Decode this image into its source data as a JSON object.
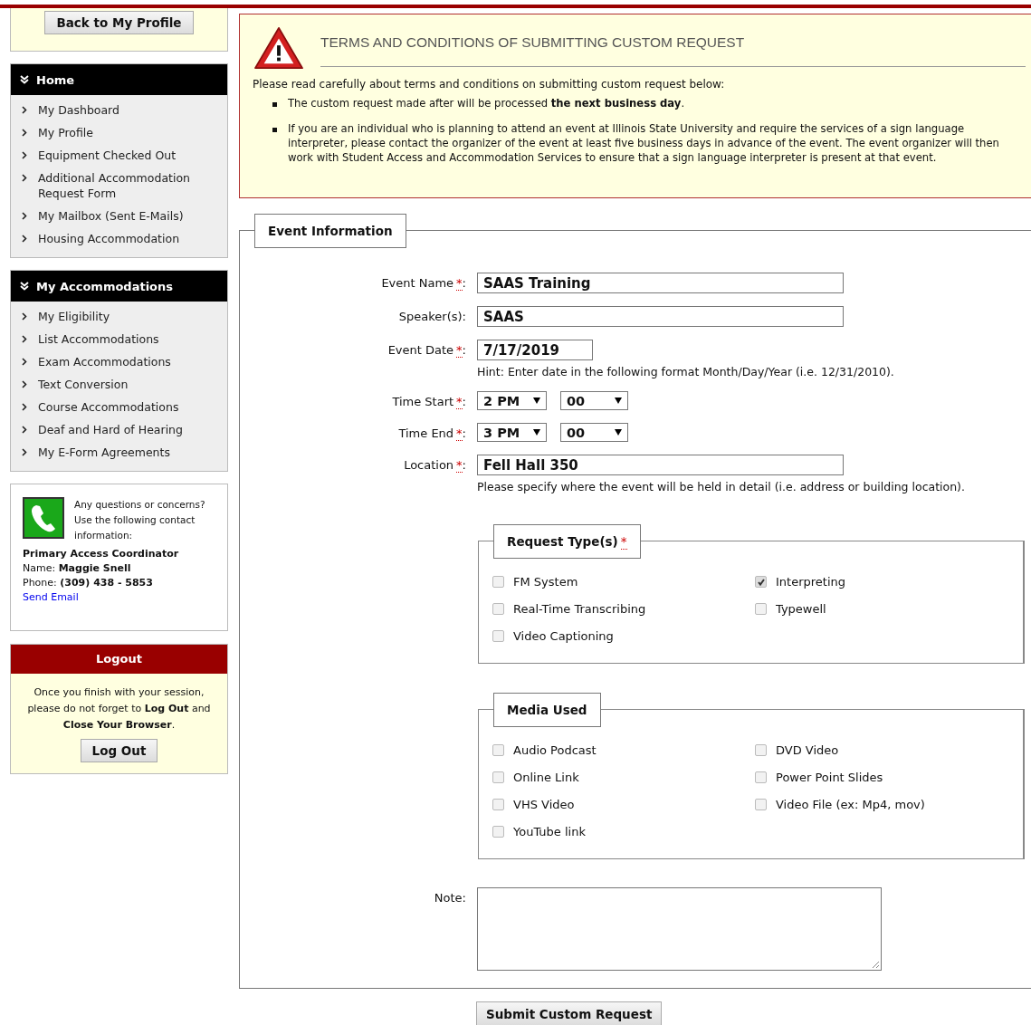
{
  "sidebar": {
    "back_button": "Back to My Profile",
    "menus": [
      {
        "title": "Home",
        "items": [
          {
            "label": "My Dashboard"
          },
          {
            "label": "My Profile"
          },
          {
            "label": "Equipment Checked Out"
          },
          {
            "label": "Additional Accommodation Request Form"
          },
          {
            "label": "My Mailbox (Sent E-Mails)"
          },
          {
            "label": "Housing Accommodation"
          }
        ]
      },
      {
        "title": "My Accommodations",
        "items": [
          {
            "label": "My Eligibility"
          },
          {
            "label": "List Accommodations"
          },
          {
            "label": "Exam Accommodations"
          },
          {
            "label": "Text Conversion"
          },
          {
            "label": "Course Accommodations"
          },
          {
            "label": "Deaf and Hard of Hearing"
          },
          {
            "label": "My E-Form Agreements"
          }
        ]
      }
    ],
    "contact": {
      "intro": "Any questions or concerns? Use the following contact information:",
      "role": "Primary Access Coordinator",
      "name": "Name: **Maggie Snell**",
      "phone": "Phone: **(309) 438 - 5853**",
      "link": "Send Email"
    },
    "logout": {
      "title": "Logout",
      "message": "Once you finish with your session, please do not forget to **Log Out** and **Close Your Browser**.",
      "button": "Log Out"
    }
  },
  "terms": {
    "title": "TERMS AND CONDITIONS OF SUBMITTING CUSTOM REQUEST",
    "intro": "Please read carefully about terms and conditions on submitting custom request below:",
    "bullets": [
      "The custom request made after will be processed **the next business day**.",
      "If you are an individual who is planning to attend an event at Illinois State University and require the services of a sign language interpreter, please contact the organizer of the event at least five business days in advance of the event. The event organizer will then work with Student Access and Accommodation Services to ensure that a sign language interpreter is present at that event."
    ]
  },
  "form": {
    "legend": "Event Information",
    "required_mark": "*",
    "label_suffix": ":",
    "fields": [
      {
        "kind": "text",
        "label": "Event Name",
        "required": true,
        "value": "SAAS Training"
      },
      {
        "kind": "text",
        "label": "Speaker(s)",
        "required": false,
        "value": "SAAS"
      },
      {
        "kind": "date",
        "label": "Event Date",
        "required": true,
        "value": "7/17/2019",
        "hint": "Hint: Enter date in the following format Month/Day/Year (i.e. 12/31/2010)."
      },
      {
        "kind": "time",
        "label": "Time Start",
        "required": true,
        "hour": "2 PM",
        "minute": "00"
      },
      {
        "kind": "time",
        "label": "Time End",
        "required": true,
        "hour": "3 PM",
        "minute": "00"
      },
      {
        "kind": "text",
        "label": "Location",
        "required": true,
        "value": "Fell Hall 350",
        "hint": "Please specify where the event will be held in detail (i.e. address or building location)."
      }
    ],
    "groups": [
      {
        "legend": "Request Type(s)",
        "required": true,
        "options": [
          {
            "label": "FM System",
            "checked": false
          },
          {
            "label": "Interpreting",
            "checked": true
          },
          {
            "label": "Real-Time Transcribing",
            "checked": false
          },
          {
            "label": "Typewell",
            "checked": false
          },
          {
            "label": "Video Captioning",
            "checked": false
          }
        ]
      },
      {
        "legend": "Media Used",
        "required": false,
        "options": [
          {
            "label": "Audio Podcast",
            "checked": false
          },
          {
            "label": "DVD Video",
            "checked": false
          },
          {
            "label": "Online Link",
            "checked": false
          },
          {
            "label": "Power Point Slides",
            "checked": false
          },
          {
            "label": "VHS Video",
            "checked": false
          },
          {
            "label": "Video File (ex: Mp4, mov)",
            "checked": false
          },
          {
            "label": "YouTube link",
            "checked": false
          }
        ]
      }
    ],
    "note_label": "Note:",
    "submit": "Submit Custom Request"
  }
}
